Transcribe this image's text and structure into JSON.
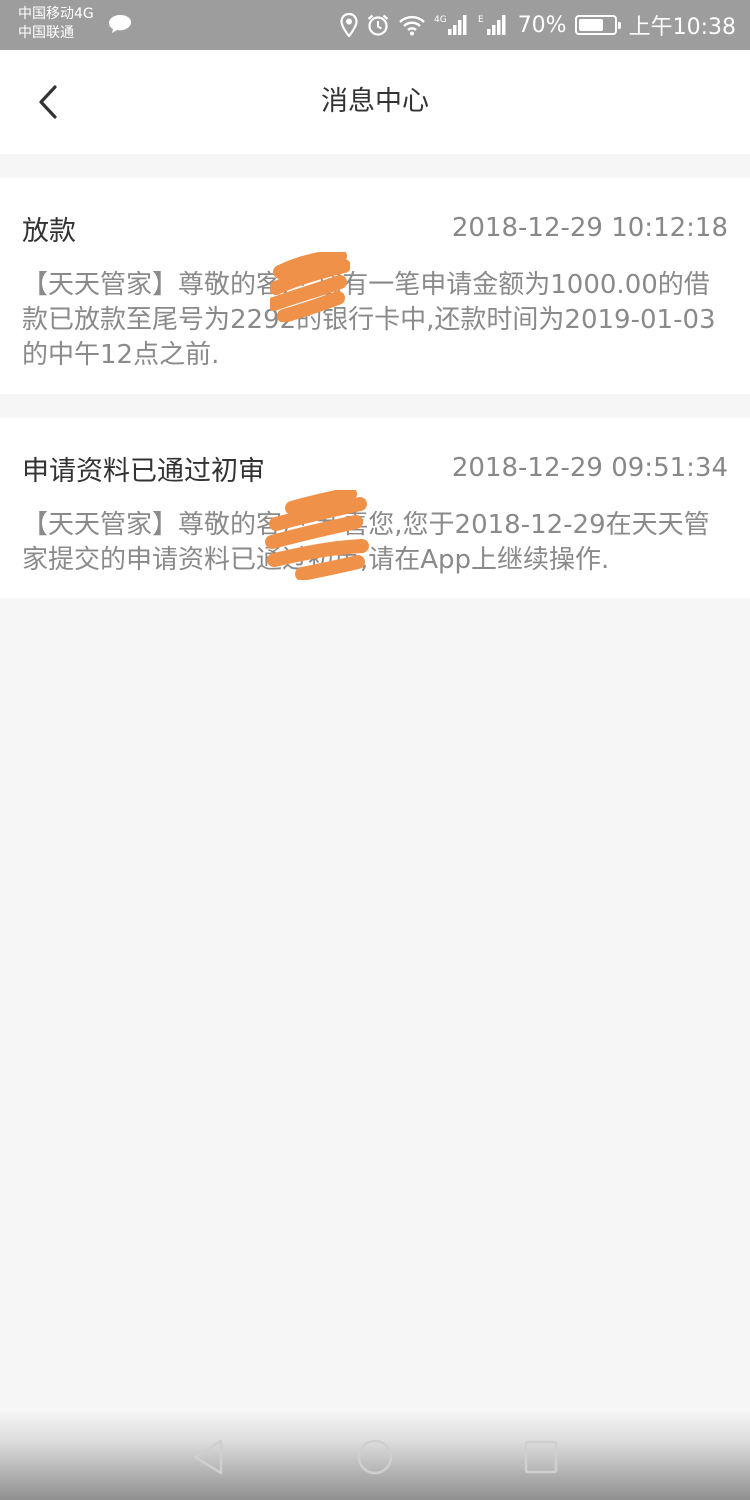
{
  "status_bar": {
    "carrier_1": "中国移动4G",
    "carrier_2": "中国联通",
    "battery_percent": "70%",
    "battery_level": 0.7,
    "time": "上午10:38",
    "icons": [
      "location-icon",
      "alarm-icon",
      "wifi-icon",
      "signal-4g-icon",
      "signal-e-icon",
      "battery-icon"
    ]
  },
  "header": {
    "title": "消息中心",
    "back_icon": "chevron-left-icon"
  },
  "messages": [
    {
      "title": "放款",
      "time": "2018-12-29 10:12:18",
      "body": "【天天管家】尊敬的客户,您有一笔申请金额为1000.00的借款已放款至尾号为2292的银行卡中,还款时间为2019-01-03的中午12点之前."
    },
    {
      "title": "申请资料已通过初审",
      "time": "2018-12-29 09:51:34",
      "body": "【天天管家】尊敬的客户,恭喜您,您于2018-12-29在天天管家提交的申请资料已通过初审,请在App上继续操作."
    }
  ],
  "nav_bar": {
    "icons": [
      "back-triangle-icon",
      "home-circle-icon",
      "recents-square-icon"
    ]
  },
  "colors": {
    "status_bar": "#9d9d9d",
    "background": "#f6f6f6",
    "redaction": "#f0914a"
  }
}
